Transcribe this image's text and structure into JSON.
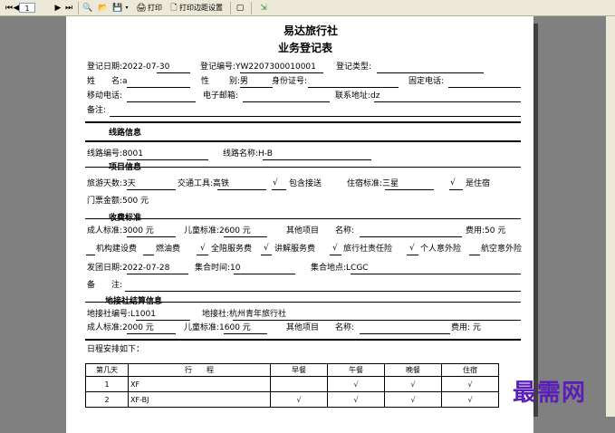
{
  "toolbar": {
    "page_number": "1",
    "print_label": "打印",
    "margin_label": "打印边距设置"
  },
  "doc": {
    "company": "易达旅行社",
    "form_title": "业务登记表",
    "reg_date": "登记日期:2022-07-30",
    "reg_no": "登记编号:YW2207300010001",
    "reg_type": "登记类型:",
    "name_label": "姓　　名:a",
    "gender_label": "性",
    "gender_value": "别:男",
    "id_label": "身份证号:",
    "phone_label": "固定电话:",
    "mobile_label": "移动电话:",
    "email_label": "电子邮箱:",
    "address_label": "联系地址:dz",
    "note_label": "备注:",
    "sec_route": "线路信息",
    "route_no": "线路编号:8001",
    "route_name": "线路名称:H-B",
    "sec_project": "项目信息",
    "days": "旅游天数:3天",
    "transport": "交通工具:高铁",
    "check_mark": "√",
    "pickup": "包含接送",
    "lodging": "住宿标准:三星",
    "is_lodging": "是住宿",
    "ticket": "门票金额:500 元",
    "sec_fee": "收费标准",
    "adult_std": "成人标准:3000 元",
    "child_std": "儿童标准:2600 元",
    "other_item": "其他项目",
    "name2": "名称:",
    "fee": "费用:50 元",
    "svc_build": "机构建设费",
    "svc_fuel": "燃油费",
    "svc_all": "全陪服务费",
    "svc_guide": "讲解服务费",
    "svc_liab": "旅行社责任险",
    "svc_personal": "个人意外险",
    "svc_air": "航空意外险",
    "depart_date": "发团日期:2022-07-28",
    "gather_time": "集合时间:10",
    "gather_place": "集合地点:LCGC",
    "remark": "备　　注:",
    "sec_ground": "地接社结算信息",
    "ground_no": "地接社编号:L1001",
    "ground_name": "地接社:杭州青年旅行社",
    "adult_std2": "成人标准:2000 元",
    "child_std2": "儿童标准:1600 元",
    "other_item2": "其他项目",
    "name3": "名称:",
    "fee2": "费用: 元",
    "schedule_intro": "日程安排如下："
  },
  "schedule": {
    "headers": [
      "第几天",
      "行　　程",
      "早餐",
      "午餐",
      "晚餐",
      "住宿"
    ],
    "rows": [
      [
        "1",
        "XF",
        "",
        "√",
        "√",
        "√"
      ],
      [
        "2",
        "XF-BJ",
        "√",
        "√",
        "√",
        "√"
      ]
    ]
  },
  "watermark": "最需网"
}
